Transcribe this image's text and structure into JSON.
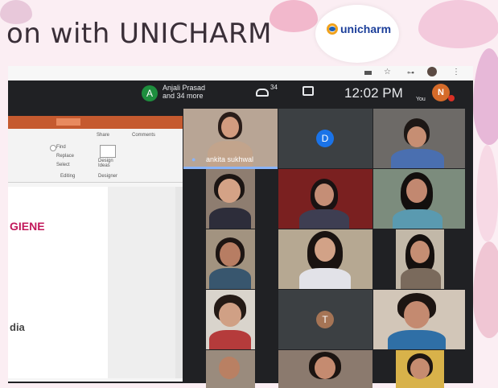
{
  "banner": {
    "heading": "on with UNICHARM",
    "logo_text": "unicharm"
  },
  "meet": {
    "host_initial": "A",
    "host_name": "Anjali Prasad",
    "host_more": "and 34 more",
    "participant_count": "34",
    "time": "12:02 PM",
    "you_label": "You",
    "you_initial": "N"
  },
  "ppt": {
    "ribbon_labels": [
      "Find",
      "Replace",
      "Select",
      "Editing",
      "Design Ideas",
      "Designer",
      "Share",
      "Comments"
    ],
    "slide_text_1": "GIENE",
    "slide_text_2": "dia"
  },
  "participants": {
    "speaker_name": "ankita sukhwal",
    "initial_d": "D",
    "initial_t": "T"
  },
  "colors": {
    "meet_bg": "#202124",
    "ppt_accent": "#c55a2f",
    "speaker": "#8ab4f8"
  }
}
